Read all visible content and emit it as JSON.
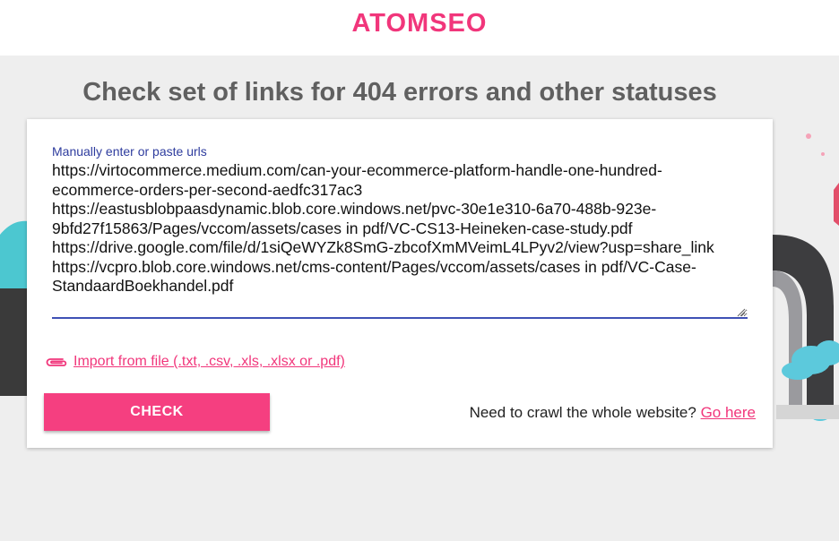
{
  "header": {
    "logo_text": "ATOMSEO"
  },
  "main": {
    "headline": "Check set of links for 404 errors and other statuses",
    "urls_field": {
      "label": "Manually enter or paste urls",
      "value": "https://virtocommerce.medium.com/can-your-ecommerce-platform-handle-one-hundred-ecommerce-orders-per-second-aedfc317ac3\nhttps://eastusblobpaasdynamic.blob.core.windows.net/pvc-30e1e310-6a70-488b-923e-9bfd27f15863/Pages/vccom/assets/cases in pdf/VC-CS13-Heineken-case-study.pdf\nhttps://drive.google.com/file/d/1siQeWYZk8SmG-zbcofXmMVeimL4LPyv2/view?usp=share_link\nhttps://vcpro.blob.core.windows.net/cms-content/Pages/vccom/assets/cases in pdf/VC-Case-StandaardBoekhandel.pdf"
    },
    "import_link": "Import from file (.txt, .csv, .xls, .xlsx or .pdf)",
    "check_button": "CHECK",
    "crawl_prompt": "Need to crawl the whole website?",
    "crawl_link": "Go here"
  },
  "colors": {
    "accent": "#f1367b",
    "button": "#f53f80",
    "field_underline": "#3f51b5"
  }
}
